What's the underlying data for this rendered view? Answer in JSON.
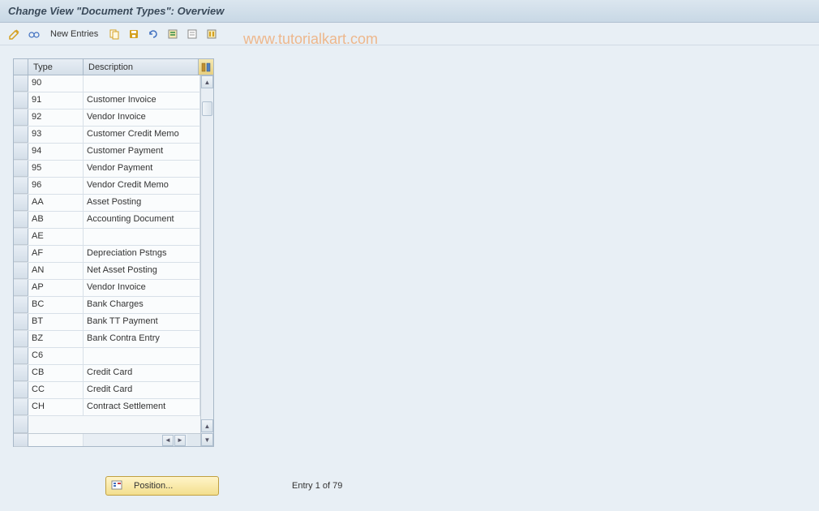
{
  "title": "Change View \"Document Types\": Overview",
  "toolbar": {
    "new_entries_label": "New Entries"
  },
  "watermark": "www.tutorialkart.com",
  "table": {
    "columns": {
      "type": "Type",
      "description": "Description"
    },
    "rows": [
      {
        "type": "90",
        "desc": ""
      },
      {
        "type": "91",
        "desc": "Customer Invoice"
      },
      {
        "type": "92",
        "desc": "Vendor Invoice"
      },
      {
        "type": "93",
        "desc": "Customer Credit Memo"
      },
      {
        "type": "94",
        "desc": "Customer Payment"
      },
      {
        "type": "95",
        "desc": "Vendor Payment"
      },
      {
        "type": "96",
        "desc": "Vendor Credit Memo"
      },
      {
        "type": "AA",
        "desc": "Asset Posting"
      },
      {
        "type": "AB",
        "desc": "Accounting Document"
      },
      {
        "type": "AE",
        "desc": ""
      },
      {
        "type": "AF",
        "desc": "Depreciation Pstngs"
      },
      {
        "type": "AN",
        "desc": "Net Asset Posting"
      },
      {
        "type": "AP",
        "desc": "Vendor Invoice"
      },
      {
        "type": "BC",
        "desc": "Bank Charges"
      },
      {
        "type": "BT",
        "desc": "Bank TT Payment"
      },
      {
        "type": "BZ",
        "desc": "Bank Contra Entry"
      },
      {
        "type": "C6",
        "desc": ""
      },
      {
        "type": "CB",
        "desc": "Credit Card"
      },
      {
        "type": "CC",
        "desc": "Credit Card"
      },
      {
        "type": "CH",
        "desc": "Contract Settlement"
      }
    ]
  },
  "footer": {
    "position_label": "Position...",
    "entry_text": "Entry 1 of 79"
  }
}
